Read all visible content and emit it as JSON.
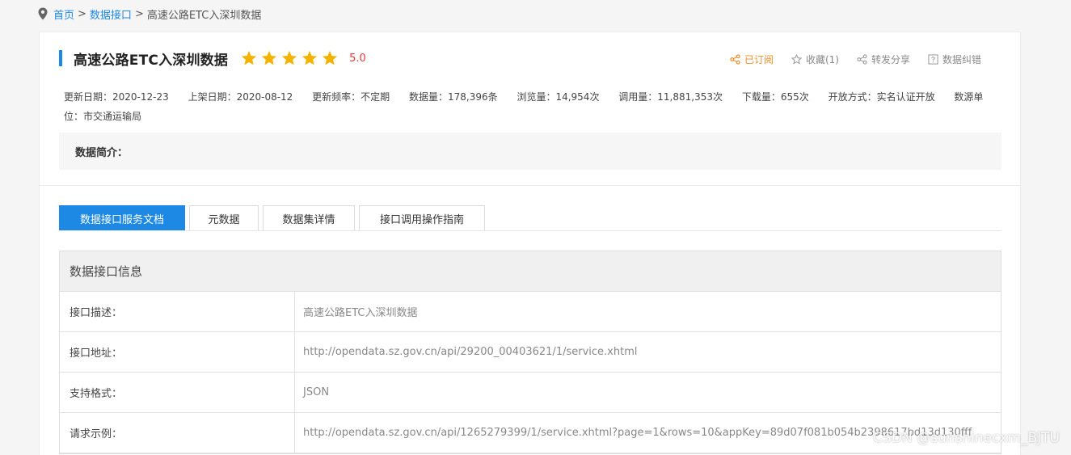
{
  "breadcrumb": {
    "home": "首页",
    "section": "数据接口",
    "separator": ">",
    "current": "高速公路ETC入深圳数据"
  },
  "dataset": {
    "title": "高速公路ETC入深圳数据",
    "rating": "5.0",
    "stars_filled": 5,
    "stars_total": 5
  },
  "actions": {
    "subscribed": "已订阅",
    "favorite": "收藏(1)",
    "share": "转发分享",
    "report": "数据纠错"
  },
  "meta": {
    "updated": "更新日期：2020-12-23",
    "published": "上架日期：2020-08-12",
    "frequency": "更新频率：不定期",
    "records": "数据量：178,396条",
    "views": "浏览量：14,954次",
    "calls": "调用量：11,881,353次",
    "downloads": "下载量：655次",
    "access": "开放方式：实名认证开放",
    "source": "数源单位：市交通运输局"
  },
  "intro": {
    "label": "数据简介："
  },
  "tabs": [
    {
      "label": "数据接口服务文档"
    },
    {
      "label": "元数据"
    },
    {
      "label": "数据集详情"
    },
    {
      "label": "接口调用操作指南"
    }
  ],
  "api_info": {
    "header": "数据接口信息",
    "rows": [
      {
        "key": "接口描述：",
        "value": "高速公路ETC入深圳数据"
      },
      {
        "key": "接口地址：",
        "value": "http://opendata.sz.gov.cn/api/29200_00403621/1/service.xhtml"
      },
      {
        "key": "支持格式：",
        "value": "JSON"
      },
      {
        "key": "请求示例：",
        "value": "http://opendata.sz.gov.cn/api/1265279399/1/service.xhtml?page=1&rows=10&appKey=89d07f081b054b2398617bd13d130fff"
      }
    ]
  },
  "watermark": "CSDN @sunshinecxm_BJTU",
  "colors": {
    "accent": "#1e88e5",
    "star": "#f5b301",
    "rating": "#e53935",
    "subscribed": "#ef8f2a"
  }
}
